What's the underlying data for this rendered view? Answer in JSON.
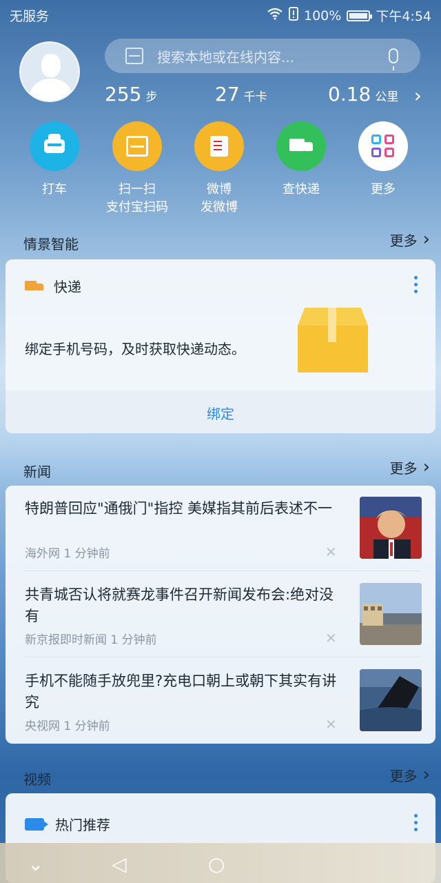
{
  "status": {
    "carrier": "无服务",
    "battery_pct": "100%",
    "time": "下午4:54"
  },
  "search": {
    "placeholder": "搜索本地或在线内容..."
  },
  "stats": [
    {
      "value": "255",
      "unit": "步"
    },
    {
      "value": "27",
      "unit": "千卡"
    },
    {
      "value": "0.18",
      "unit": "公里"
    }
  ],
  "quick_actions": [
    {
      "label": "打车",
      "icon": "taxi-icon",
      "color": "#1db3e6"
    },
    {
      "label": "扫一扫\n支付宝扫码",
      "icon": "scan-icon",
      "color": "#f6b62a"
    },
    {
      "label": "微博\n发微博",
      "icon": "weibo-pen-icon",
      "color": "#f6b62a"
    },
    {
      "label": "查快递",
      "icon": "truck-icon",
      "color": "#33c05a"
    },
    {
      "label": "更多",
      "icon": "apps-grid-icon",
      "color": "#ffffff"
    }
  ],
  "sections": {
    "scene": {
      "title": "情景智能",
      "more": "更多"
    },
    "news": {
      "title": "新闻",
      "more": "更多"
    },
    "video": {
      "title": "视频",
      "more": "更多"
    }
  },
  "express_card": {
    "title": "快递",
    "description": "绑定手机号码，及时获取快递动态。",
    "action": "绑定"
  },
  "news_items": [
    {
      "headline": "特朗普回应\"通俄门\"指控 美媒指其前后表述不一",
      "source": "海外网",
      "time": "1 分钟前"
    },
    {
      "headline": "共青城否认将就赛龙事件召开新闻发布会:绝对没有",
      "source": "新京报即时新闻",
      "time": "1 分钟前"
    },
    {
      "headline": "手机不能随手放兜里?充电口朝上或朝下其实有讲究",
      "source": "央视网",
      "time": "1 分钟前"
    }
  ],
  "video_card": {
    "title": "热门推荐"
  }
}
